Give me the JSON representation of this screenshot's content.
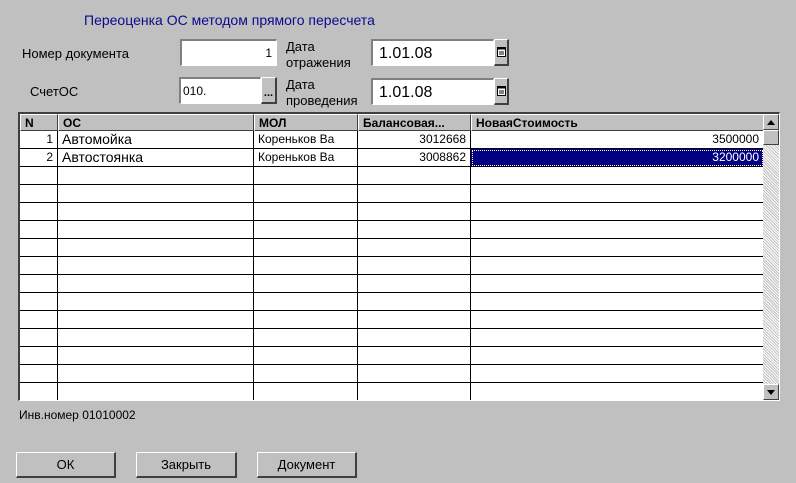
{
  "title": "Переоценка ОС методом прямого пересчета",
  "form": {
    "doc_number_label": "Номер документа",
    "doc_number_value": "1",
    "date_reflect_label_1": "Дата",
    "date_reflect_label_2": "отражения",
    "date_reflect_value": "1.01.08",
    "account_label": "СчетОС",
    "account_value": "010.",
    "account_browse": "...",
    "date_exec_label_1": "Дата",
    "date_exec_label_2": "проведения",
    "date_exec_value": "1.01.08"
  },
  "table": {
    "columns": [
      "N",
      "ОС",
      "МОЛ",
      "Балансовая...",
      "НоваяСтоимость"
    ],
    "rows": [
      {
        "n": "1",
        "os": "Автомойка",
        "mol": "Кореньков Ва",
        "balance": "3012668",
        "new_cost": "3500000"
      },
      {
        "n": "2",
        "os": "Автостоянка",
        "mol": "Кореньков Ва",
        "balance": "3008862",
        "new_cost": "3200000"
      }
    ],
    "selected_row": 1
  },
  "inv_number": "Инв.номер 01010002",
  "buttons": {
    "ok": "ОК",
    "close": "Закрыть",
    "document": "Документ"
  }
}
